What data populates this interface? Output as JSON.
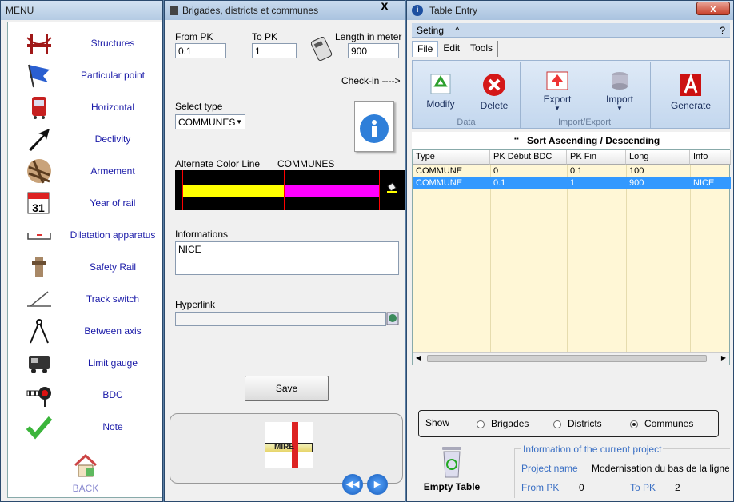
{
  "menu": {
    "title": "MENU",
    "back": "BACK",
    "items": [
      {
        "label": "Structures",
        "icon": "bridge-icon"
      },
      {
        "label": "Particular point",
        "icon": "flag-icon"
      },
      {
        "label": "Horizontal",
        "icon": "train-icon"
      },
      {
        "label": "Declivity",
        "icon": "arrow-up-icon"
      },
      {
        "label": "Armement",
        "icon": "rail-sleepers-icon"
      },
      {
        "label": "Year of rail",
        "icon": "calendar-icon"
      },
      {
        "label": "Dilatation apparatus",
        "icon": "dilatation-icon"
      },
      {
        "label": "Safety Rail",
        "icon": "safety-rail-icon"
      },
      {
        "label": "Track switch",
        "icon": "track-switch-icon"
      },
      {
        "label": "Between axis",
        "icon": "compass-icon"
      },
      {
        "label": "Limit gauge",
        "icon": "locomotive-icon"
      },
      {
        "label": "BDC",
        "icon": "signal-icon"
      },
      {
        "label": "Note",
        "icon": "checkmark-icon"
      }
    ]
  },
  "brigades": {
    "title": "Brigades, districts et communes",
    "close": "x",
    "from_pk_label": "From PK",
    "from_pk": "0.1",
    "to_pk_label": "To PK",
    "to_pk": "1",
    "length_label": "Length in meter",
    "length": "900",
    "checkin": "Check-in ---->",
    "select_type_label": "Select type",
    "select_type": "COMMUNES",
    "alt_color_label": "Alternate Color Line",
    "alt_color_value": "COMMUNES",
    "informations_label": "Informations",
    "informations": "NICE",
    "hyperlink_label": "Hyperlink",
    "hyperlink": "",
    "save": "Save",
    "logo": "MIRE",
    "colors": {
      "yellow": "#ffff00",
      "magenta": "#ff00ff",
      "red": "#ff0000"
    }
  },
  "table": {
    "title": "Table Entry",
    "close": "x",
    "seting": "Seting",
    "caret": "^",
    "help": "?",
    "tabs": [
      "File",
      "Edit",
      "Tools"
    ],
    "buttons": {
      "modify": "Modify",
      "delete": "Delete",
      "export": "Export",
      "import": "Import",
      "generate": "Generate"
    },
    "groups": {
      "data": "Data",
      "impexp": "Import/Export"
    },
    "sort": "Sort Ascending / Descending",
    "columns": [
      "Type",
      "PK Début BDC",
      "PK Fin",
      "Long",
      "Info"
    ],
    "rows": [
      [
        "COMMUNE",
        "0",
        "0.1",
        "100",
        ""
      ],
      [
        "COMMUNE",
        "0.1",
        "1",
        "900",
        "NICE"
      ]
    ],
    "show_label": "Show",
    "show_options": [
      "Brigades",
      "Districts",
      "Communes"
    ],
    "show_selected": "Communes",
    "empty_table": "Empty Table",
    "info_title": "Information of the current project",
    "project_name_label": "Project name",
    "project_name": "Modernisation du bas de la ligne de",
    "from_pk_label": "From PK",
    "from_pk": "0",
    "to_pk_label": "To PK",
    "to_pk": "2"
  }
}
